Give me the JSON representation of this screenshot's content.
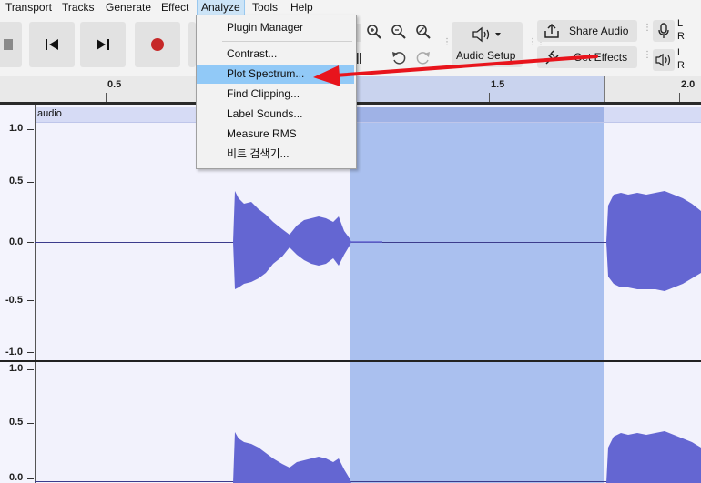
{
  "menubar": {
    "items": [
      "Transport",
      "Tracks",
      "Generate",
      "Effect",
      "Analyze",
      "Tools",
      "Help"
    ],
    "active": "Analyze"
  },
  "toolbar": {
    "audio_setup_label": "Audio Setup",
    "share_audio_label": "Share Audio",
    "get_effects_label": "Get Effects",
    "meter_channel_l": "L",
    "meter_channel_r": "R"
  },
  "analyze_menu": {
    "items": [
      {
        "label": "Plugin Manager"
      },
      {
        "label": "Contrast..."
      },
      {
        "label": "Plot Spectrum...",
        "highlighted": true
      },
      {
        "label": "Find Clipping..."
      },
      {
        "label": "Label Sounds..."
      },
      {
        "label": "Measure RMS"
      },
      {
        "label": "비트 검색기..."
      }
    ]
  },
  "timeline": {
    "tick_labels": [
      "0.5",
      "1.5",
      "2.0"
    ]
  },
  "track": {
    "clip_name": "audio",
    "amplitude_labels": [
      "1.0",
      "0.5",
      "0.0",
      "-0.5",
      "-1.0"
    ],
    "amplitude_labels_channel2": [
      "1.0",
      "0.5",
      "0.0"
    ]
  },
  "colors": {
    "waveform": "#6466d2",
    "selection": "#aac0ef",
    "menu_highlight": "#91c9f7",
    "annotation_arrow": "#e8141c",
    "record_button": "#c62828"
  },
  "annotation": {
    "type": "arrow",
    "points_to": "Plot Spectrum..."
  }
}
